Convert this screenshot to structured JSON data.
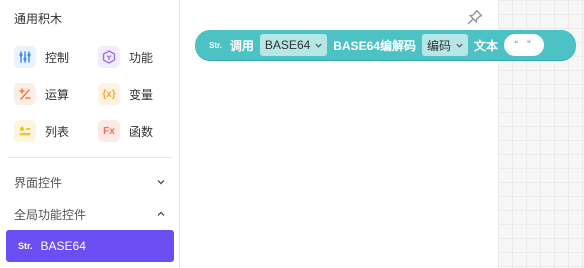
{
  "palette": {
    "section_title": "通用积木",
    "categories": [
      {
        "label": "控制",
        "icon": "sliders-icon",
        "color": "#3c8df7"
      },
      {
        "label": "功能",
        "icon": "hexagon-icon",
        "color": "#a06cf0"
      },
      {
        "label": "运算",
        "icon": "plus-minus-icon",
        "color": "#ef7d45"
      },
      {
        "label": "变量",
        "icon": "variable-icon",
        "color": "#f0a830"
      },
      {
        "label": "列表",
        "icon": "list-icon",
        "color": "#f0c430"
      },
      {
        "label": "函数",
        "icon": "function-icon",
        "color": "#ef6f55"
      }
    ],
    "groups": [
      {
        "label": "界面控件",
        "state": "collapsed"
      },
      {
        "label": "全局功能控件",
        "state": "expanded"
      }
    ],
    "active_item": {
      "tag": "Str.",
      "label": "BASE64",
      "color": "#6b4ef1"
    }
  },
  "block": {
    "tag": "Str.",
    "text_call": "调用",
    "module_value": "BASE64",
    "text_op": "BASE64编解码",
    "mode_value": "编码",
    "text_text": "文本",
    "string_value": "“ ”",
    "color": "#4cc2c4"
  },
  "colors": {
    "accent": "#6b4ef1",
    "block": "#4cc2c4"
  }
}
